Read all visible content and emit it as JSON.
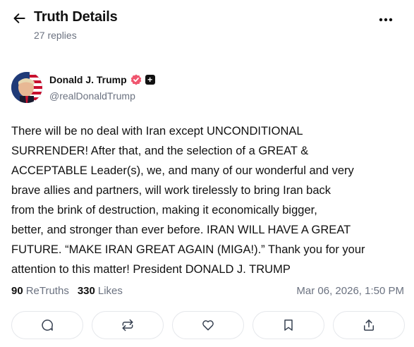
{
  "header": {
    "title": "Truth Details",
    "reply_count": "27 replies",
    "back_icon": "arrow-left-icon",
    "more_icon": "more-horizontal-icon"
  },
  "author": {
    "name": "Donald J. Trump",
    "handle": "@realDonaldTrump",
    "verified_color": "#f0566f",
    "plus_badge": "+"
  },
  "post": {
    "text": "There will be no deal with Iran except UNCONDITIONAL\nSURRENDER! After that, and the selection of a GREAT &\nACCEPTABLE Leader(s), we, and many of our wonderful and very\nbrave allies and partners, will work tirelessly to bring Iran back\nfrom the brink of destruction, making it economically bigger,\nbetter, and stronger than ever before. IRAN WILL HAVE A GREAT\nFUTURE. “MAKE IRAN GREAT AGAIN (MIGA!).” Thank you for your\nattention to this matter! President DONALD J. TRUMP"
  },
  "stats": {
    "retruths_count": "90",
    "retruths_label": "ReTruths",
    "likes_count": "330",
    "likes_label": "Likes",
    "timestamp": "Mar 06, 2026, 1:50 PM"
  },
  "actions": [
    {
      "icon": "reply-icon"
    },
    {
      "icon": "retruth-icon"
    },
    {
      "icon": "like-icon"
    },
    {
      "icon": "bookmark-icon"
    },
    {
      "icon": "share-icon"
    }
  ]
}
